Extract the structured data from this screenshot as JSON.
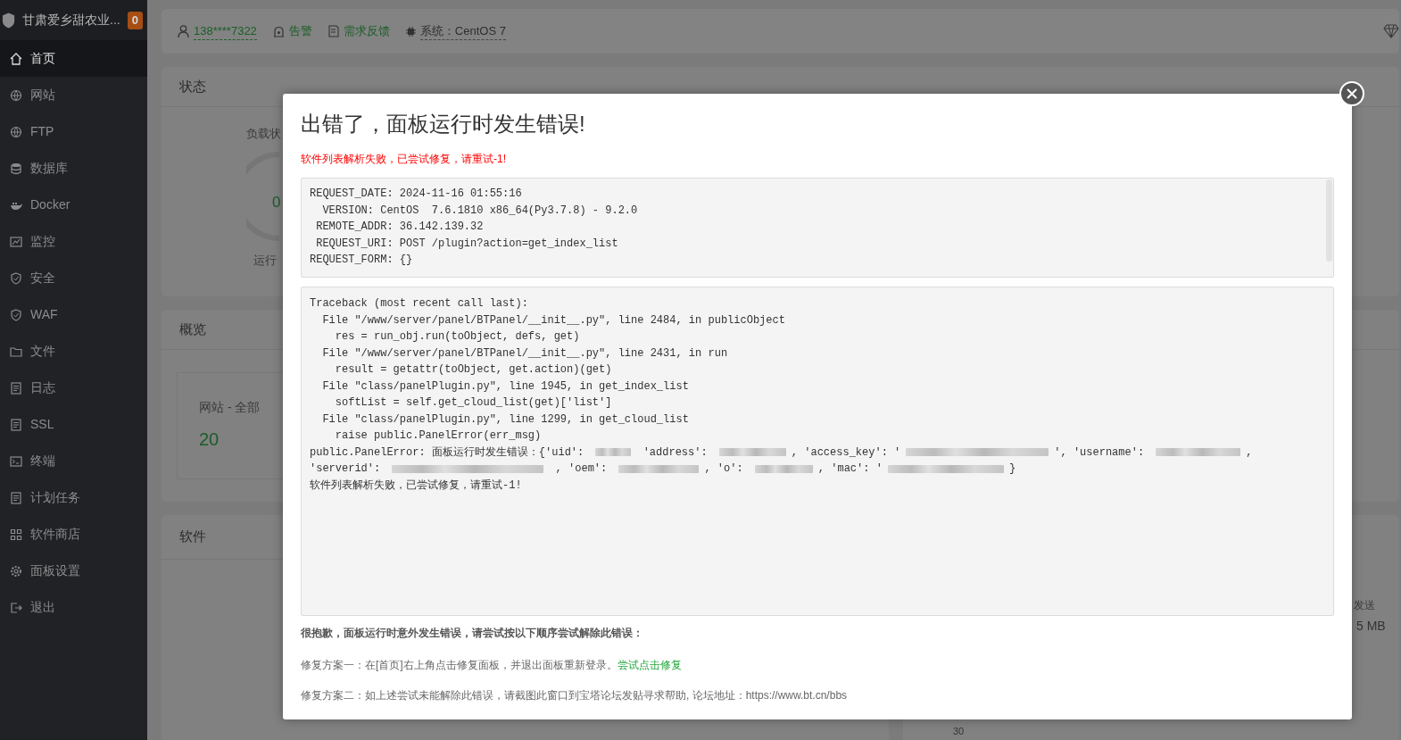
{
  "sidebar": {
    "title": "甘肃爱乡甜农业...",
    "badge": "0",
    "items": [
      {
        "label": "首页",
        "selected": true
      },
      {
        "label": "网站",
        "selected": false
      },
      {
        "label": "FTP",
        "selected": false
      },
      {
        "label": "数据库",
        "selected": false
      },
      {
        "label": "Docker",
        "selected": false
      },
      {
        "label": "监控",
        "selected": false
      },
      {
        "label": "安全",
        "selected": false
      },
      {
        "label": "WAF",
        "selected": false
      },
      {
        "label": "文件",
        "selected": false
      },
      {
        "label": "日志",
        "selected": false
      },
      {
        "label": "SSL",
        "selected": false
      },
      {
        "label": "终端",
        "selected": false
      },
      {
        "label": "计划任务",
        "selected": false
      },
      {
        "label": "软件商店",
        "selected": false
      },
      {
        "label": "面板设置",
        "selected": false
      },
      {
        "label": "退出",
        "selected": false
      }
    ]
  },
  "topbar": {
    "user": "138****7322",
    "alarm": "告警",
    "feedback": "需求反馈",
    "system": "系统：CentOS 7"
  },
  "status_card": {
    "title": "状态",
    "load_label": "负载状",
    "load_value": "0",
    "run_label": "运行"
  },
  "overview_card": {
    "title": "概览",
    "site_label": "网站 - 全部",
    "site_count": "20"
  },
  "software_card": {
    "title": "软件"
  },
  "traffic": {
    "send_label": "发送",
    "send_value": "5 MB",
    "axis_tick": "30"
  },
  "dialog": {
    "title": "出错了，面板运行时发生错误!",
    "message": "软件列表解析失败，已尝试修复，请重试-1!",
    "request_info": [
      "REQUEST_DATE: 2024-11-16 01:55:16",
      "  VERSION: CentOS  7.6.1810 x86_64(Py3.7.8) - 9.2.0",
      " REMOTE_ADDR: 36.142.139.32",
      " REQUEST_URI: POST /plugin?action=get_index_list",
      "REQUEST_FORM: {}"
    ],
    "traceback": [
      {
        "parts": [
          {
            "kind": "text",
            "text": "Traceback (most recent call last):"
          }
        ]
      },
      {
        "parts": [
          {
            "kind": "text",
            "text": "  File \"/www/server/panel/BTPanel/__init__.py\", line 2484, in publicObject"
          }
        ]
      },
      {
        "parts": [
          {
            "kind": "text",
            "text": "    res = run_obj.run(toObject, defs, get)"
          }
        ]
      },
      {
        "parts": [
          {
            "kind": "text",
            "text": "  File \"/www/server/panel/BTPanel/__init__.py\", line 2431, in run"
          }
        ]
      },
      {
        "parts": [
          {
            "kind": "text",
            "text": "    result = getattr(toObject, get.action)(get)"
          }
        ]
      },
      {
        "parts": [
          {
            "kind": "text",
            "text": "  File \"class/panelPlugin.py\", line 1945, in get_index_list"
          }
        ]
      },
      {
        "parts": [
          {
            "kind": "text",
            "text": "    softList = self.get_cloud_list(get)['list']"
          }
        ]
      },
      {
        "parts": [
          {
            "kind": "text",
            "text": "  File \"class/panelPlugin.py\", line 1299, in get_cloud_list"
          }
        ]
      },
      {
        "parts": [
          {
            "kind": "text",
            "text": "    raise public.PanelError(err_msg)"
          }
        ]
      },
      {
        "parts": [
          {
            "kind": "text",
            "text": "public.PanelError: 面板运行时发生错误：{'uid': "
          },
          {
            "kind": "redacted"
          },
          {
            "kind": "text",
            "text": " 'address': "
          },
          {
            "kind": "redacted"
          },
          {
            "kind": "text",
            "text": ", 'access_key': '"
          },
          {
            "kind": "redacted"
          },
          {
            "kind": "text",
            "text": "', 'username': "
          },
          {
            "kind": "redacted"
          },
          {
            "kind": "text",
            "text": ","
          }
        ]
      },
      {
        "parts": [
          {
            "kind": "text",
            "text": "'serverid': "
          },
          {
            "kind": "redacted"
          },
          {
            "kind": "text",
            "text": " , 'oem': "
          },
          {
            "kind": "redacted"
          },
          {
            "kind": "text",
            "text": ", 'o': "
          },
          {
            "kind": "redacted"
          },
          {
            "kind": "text",
            "text": ", 'mac': '"
          },
          {
            "kind": "redacted"
          },
          {
            "kind": "text",
            "text": "}"
          }
        ]
      },
      {
        "parts": [
          {
            "kind": "text",
            "text": "软件列表解析失败，已尝试修复，请重试-1!"
          }
        ]
      }
    ],
    "help_title": "很抱歉，面板运行时意外发生错误，请尝试按以下顺序尝试解除此错误：",
    "fix_one": "修复方案一：在[首页]右上角点击修复面板，并退出面板重新登录。",
    "fix_one_link": "尝试点击修复",
    "fix_two": "修复方案二：如上述尝试未能解除此错误，请截图此窗口到宝塔论坛发贴寻求帮助, 论坛地址：https://www.bt.cn/bbs"
  }
}
